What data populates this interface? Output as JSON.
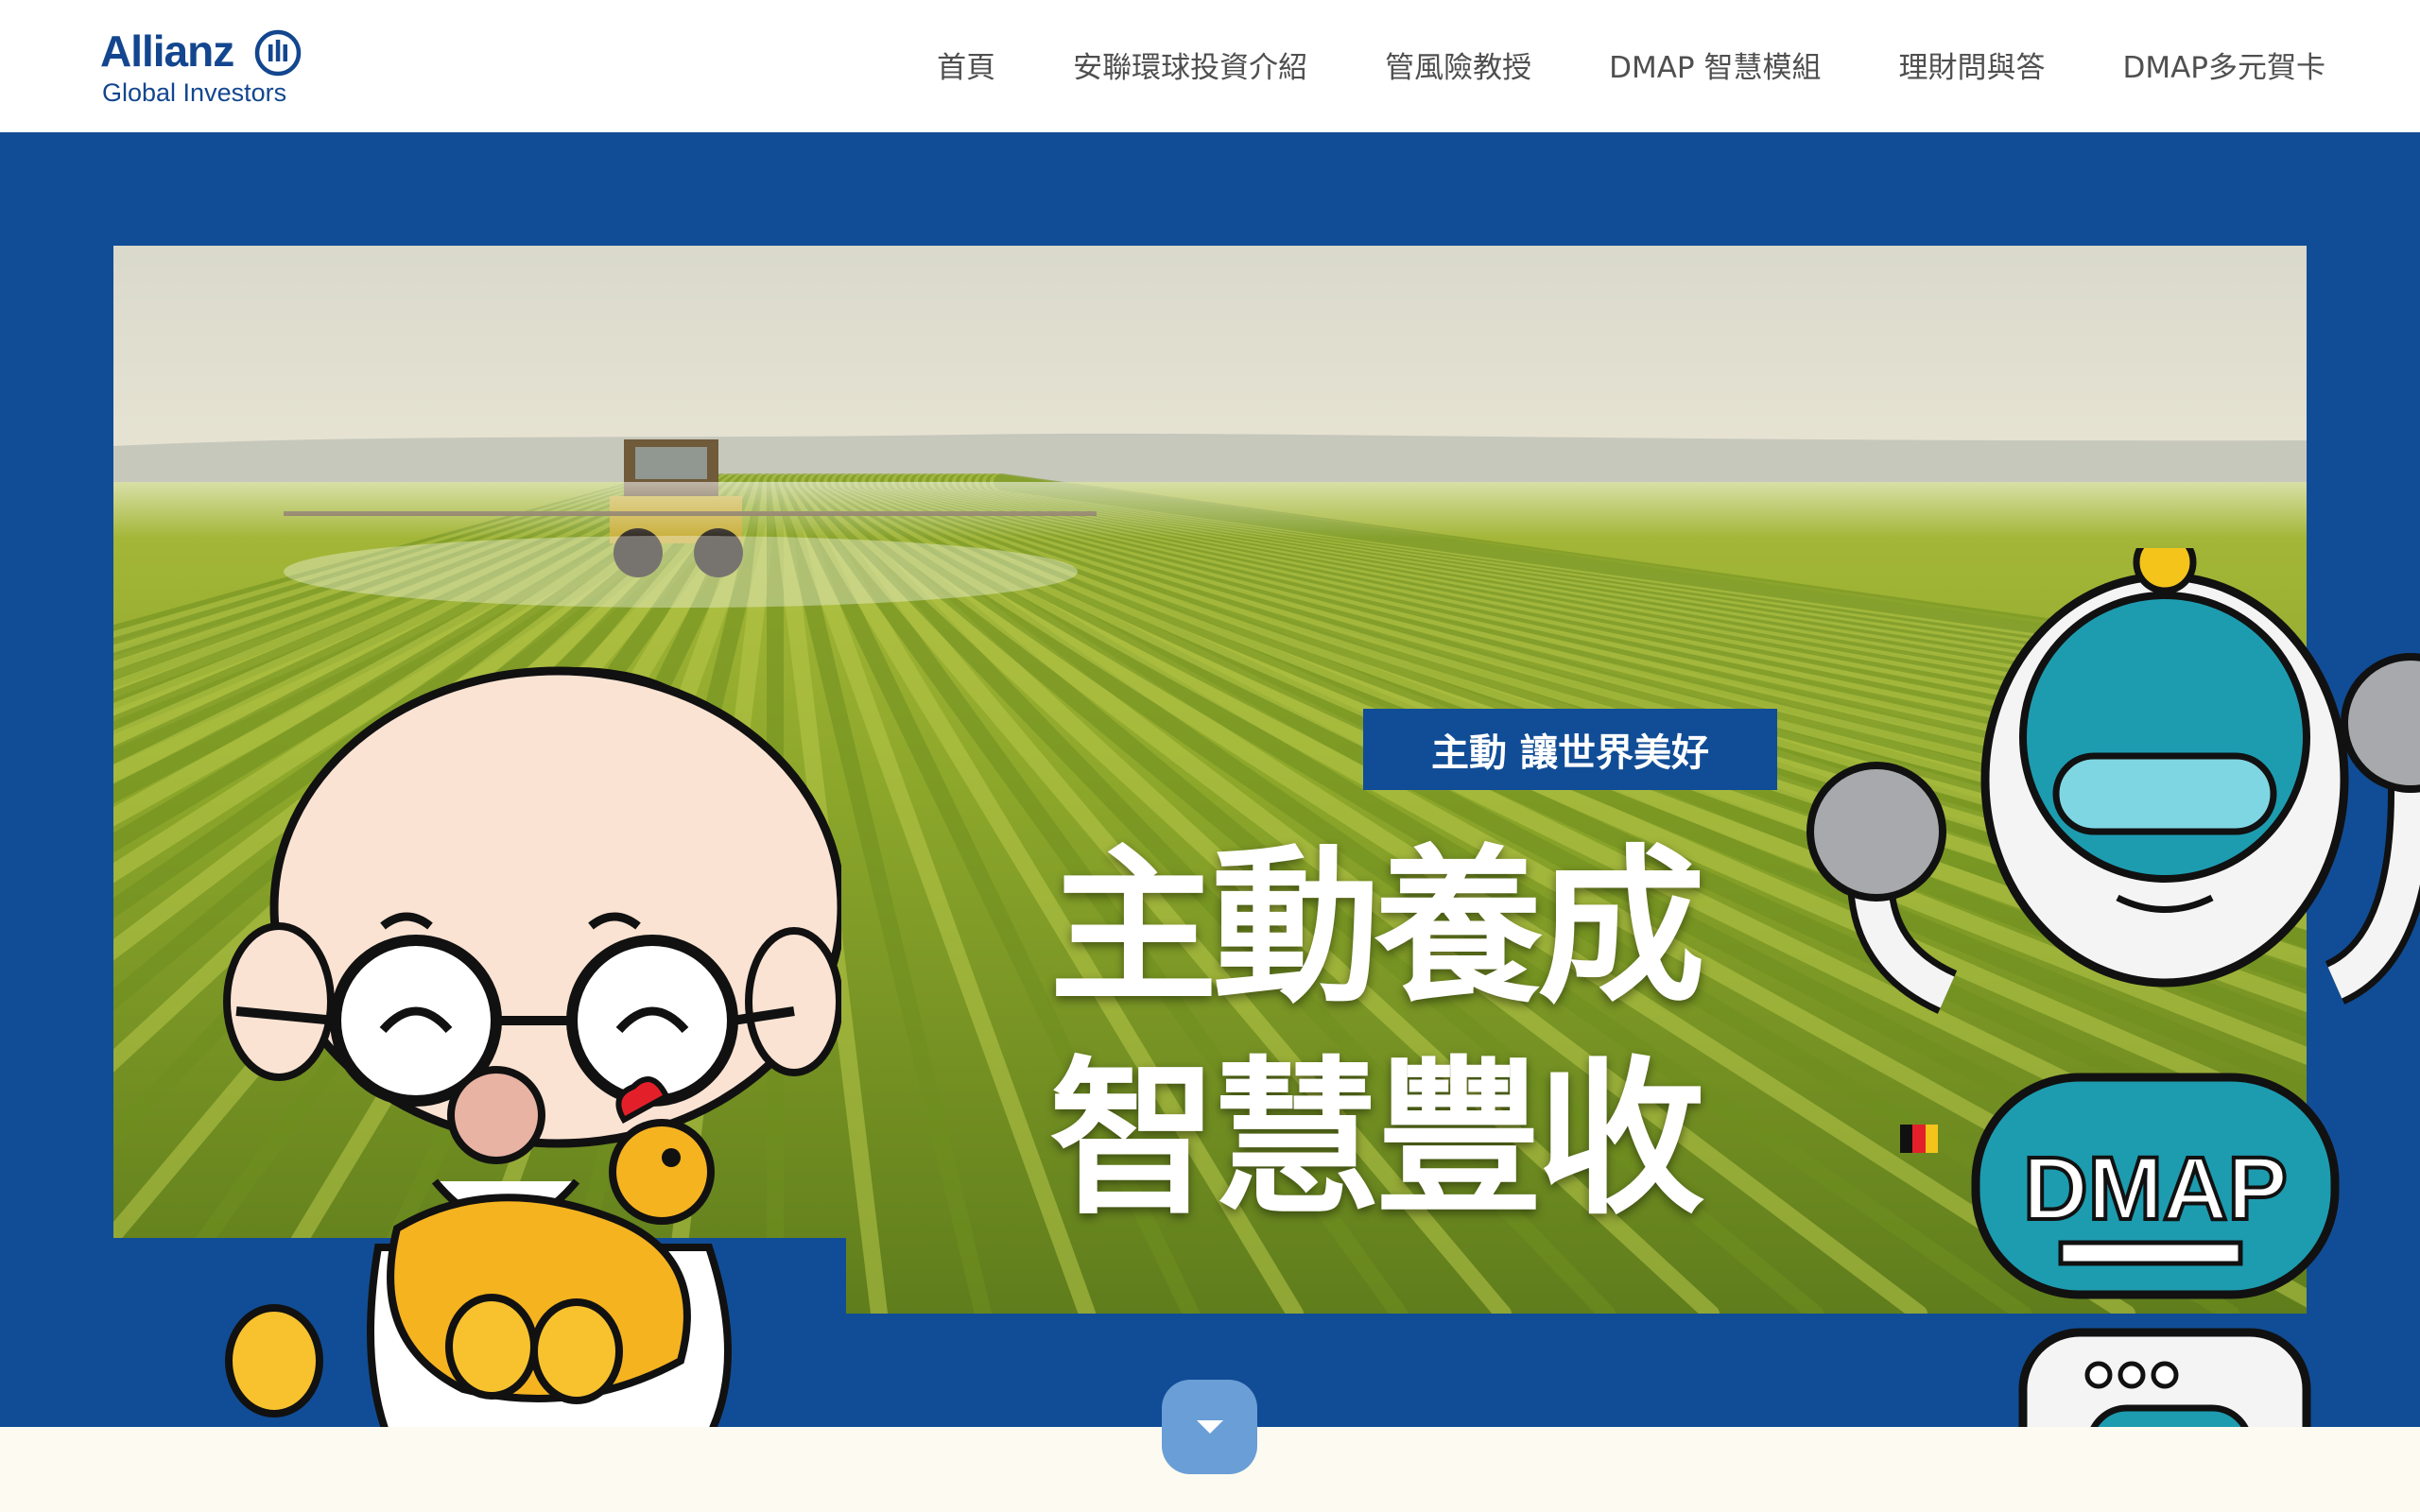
{
  "header": {
    "logo": {
      "brand": "Allianz",
      "sub": "Global Investors"
    },
    "nav": [
      {
        "label": "首頁"
      },
      {
        "label": "安聯環球投資介紹"
      },
      {
        "label": "管風險教授"
      },
      {
        "label": "DMAP 智慧模組"
      },
      {
        "label": "理財問與答"
      },
      {
        "label": "DMAP多元賀卡"
      }
    ]
  },
  "hero": {
    "tagline": "主動 讓世界美好",
    "headline": [
      "主動養成",
      "智慧豐收"
    ],
    "robot_label": "DMAP"
  },
  "icons": {
    "logo_mark": "allianz-eagle-mark-icon",
    "scroll": "chevron-down-icon"
  },
  "colors": {
    "brand_blue": "#114d96",
    "logo_blue": "#13468f",
    "scroll_button": "#6a9ed6",
    "page_bg": "#fdfaf1"
  }
}
